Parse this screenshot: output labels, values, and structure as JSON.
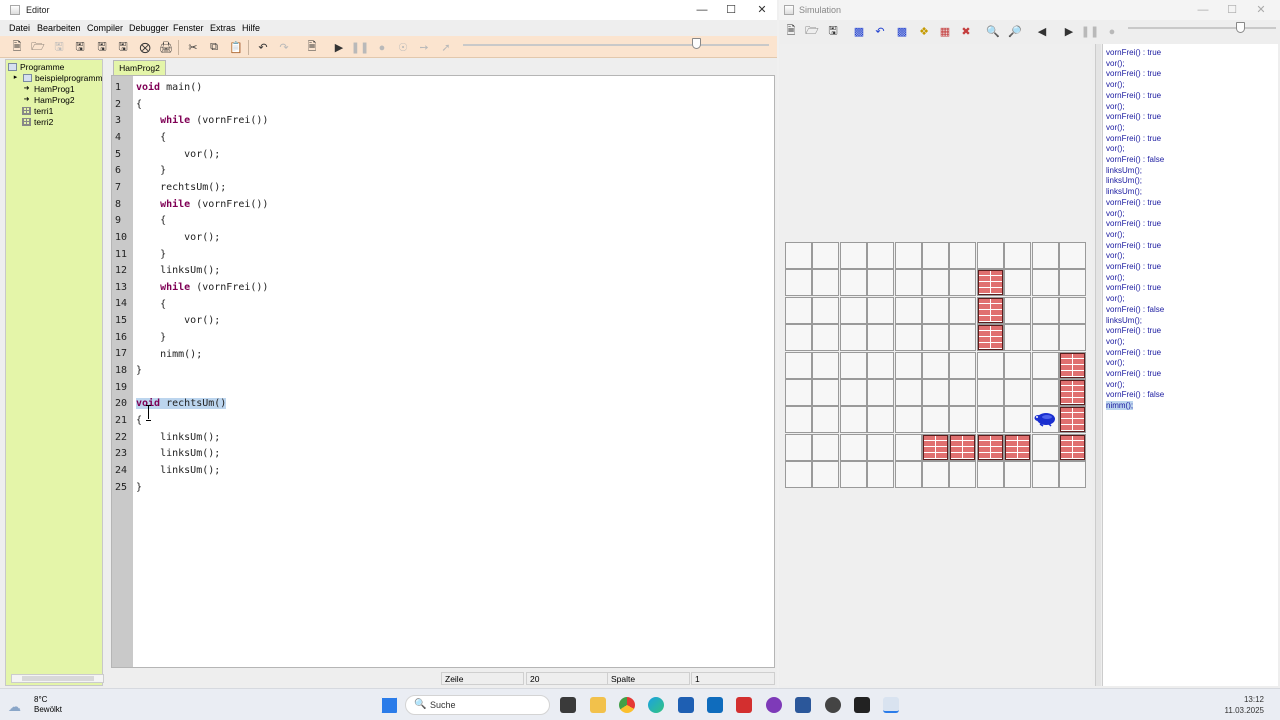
{
  "editor": {
    "title": "Editor",
    "menu": [
      "Datei",
      "Bearbeiten",
      "Compiler",
      "Debugger",
      "Fenster",
      "Extras",
      "Hilfe"
    ],
    "tree": {
      "root": "Programme",
      "folder": "beispielprogramm",
      "items": [
        "HamProg1",
        "HamProg2",
        "terri1",
        "terri2"
      ]
    },
    "tab": "HamProg2",
    "lines": [
      "1",
      "2",
      "3",
      "4",
      "5",
      "6",
      "7",
      "8",
      "9",
      "10",
      "11",
      "12",
      "13",
      "14",
      "15",
      "16",
      "17",
      "18",
      "19",
      "20",
      "21",
      "22",
      "23",
      "24",
      "25"
    ],
    "code": {
      "l1a": "void",
      "l1b": " main()",
      "l2": "{",
      "l3a": "    while",
      "l3b": " (vornFrei())",
      "l4": "    {",
      "l5": "        vor();",
      "l6": "    }",
      "l7": "    rechtsUm();",
      "l8a": "    while",
      "l8b": " (vornFrei())",
      "l9": "    {",
      "l10": "        vor();",
      "l11": "    }",
      "l12": "    linksUm();",
      "l13a": "    while",
      "l13b": " (vornFrei())",
      "l14": "    {",
      "l15": "        vor();",
      "l16": "    }",
      "l17": "    nimm();",
      "l18": "}",
      "l19": "",
      "l20a": "void",
      "l20b": " rechtsUm()",
      "l21": "{",
      "l22": "    linksUm();",
      "l23": "    linksUm();",
      "l24": "    linksUm();",
      "l25": "}"
    },
    "status": {
      "row_label": "Zeile",
      "row": "20",
      "col_label": "Spalte",
      "col": "1"
    },
    "slider_level": 0.76
  },
  "simulation": {
    "title": "Simulation",
    "slider_level": 0.76,
    "log": [
      "vornFrei() : true",
      "vor();",
      "vornFrei() : true",
      "vor();",
      "vornFrei() : true",
      "vor();",
      "vornFrei() : true",
      "vor();",
      "vornFrei() : true",
      "vor();",
      "vornFrei() : false",
      "linksUm();",
      "linksUm();",
      "linksUm();",
      "vornFrei() : true",
      "vor();",
      "vornFrei() : true",
      "vor();",
      "vornFrei() : true",
      "vor();",
      "vornFrei() : true",
      "vor();",
      "vornFrei() : true",
      "vor();",
      "vornFrei() : false",
      "linksUm();",
      "vornFrei() : true",
      "vor();",
      "vornFrei() : true",
      "vor();",
      "vornFrei() : true",
      "vor();",
      "vornFrei() : false",
      "nimm();"
    ],
    "territory": {
      "cols": 11,
      "rows": 9,
      "walls": [
        [
          1,
          7
        ],
        [
          2,
          7
        ],
        [
          3,
          7
        ],
        [
          4,
          10
        ],
        [
          5,
          10
        ],
        [
          6,
          10
        ],
        [
          7,
          5
        ],
        [
          7,
          6
        ],
        [
          7,
          7
        ],
        [
          7,
          8
        ],
        [
          7,
          10
        ]
      ],
      "hamster": [
        6,
        9
      ],
      "hamster_facing": "west"
    }
  },
  "taskbar": {
    "weather_temp": "8°C",
    "weather_text": "Bewölkt",
    "search_placeholder": "Suche",
    "time": "13:12",
    "date": "11.03.2025"
  }
}
